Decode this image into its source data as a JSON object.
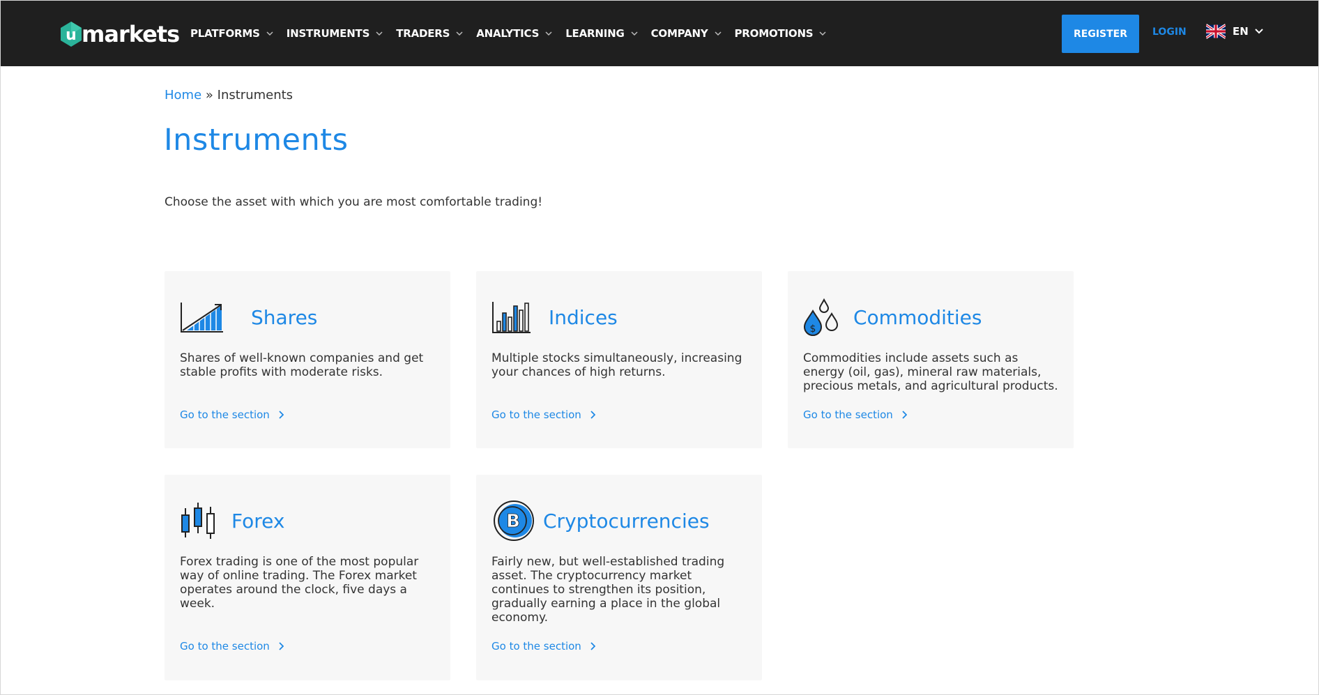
{
  "brand": {
    "logo_letter": "u",
    "logo_text": "markets"
  },
  "nav": {
    "items": [
      {
        "label": "PLATFORMS"
      },
      {
        "label": "INSTRUMENTS"
      },
      {
        "label": "TRADERS"
      },
      {
        "label": "ANALYTICS"
      },
      {
        "label": "LEARNING"
      },
      {
        "label": "COMPANY"
      },
      {
        "label": "PROMOTIONS"
      }
    ],
    "register_label": "REGISTER",
    "login_label": "LOGIN",
    "language": "EN"
  },
  "breadcrumb": {
    "home": "Home",
    "separator": "»",
    "current": "Instruments"
  },
  "page": {
    "title": "Instruments",
    "intro": "Choose the asset with which you are most comfortable trading!"
  },
  "cards": [
    {
      "title": "Shares",
      "icon": "growth-chart-icon",
      "description": "Shares of well-known companies and get stable profits with moderate risks.",
      "link": "Go to the section"
    },
    {
      "title": "Indices",
      "icon": "bar-chart-icon",
      "description": "Multiple stocks simultaneously, increasing your chances of high returns.",
      "link": "Go to the section"
    },
    {
      "title": "Commodities",
      "icon": "oil-drops-icon",
      "description": "Commodities include assets such as energy (oil, gas), mineral raw materials, precious metals, and agricultural products.",
      "link": "Go to the section"
    },
    {
      "title": "Forex",
      "icon": "candlestick-icon",
      "description": "Forex trading is one of the most popular way of online trading. The Forex market operates around the clock, five days a week.",
      "link": "Go to the section"
    },
    {
      "title": "Cryptocurrencies",
      "icon": "bitcoin-coin-icon",
      "description": "Fairly new, but well-established trading asset. The cryptocurrency market continues to strengthen its position, gradually earning a place in the global economy.",
      "link": "Go to the section"
    }
  ],
  "colors": {
    "header_bg": "#1f1f1f",
    "accent": "#1e88e5",
    "logo_green": "#2bb39a",
    "card_bg": "#f7f7f7"
  }
}
